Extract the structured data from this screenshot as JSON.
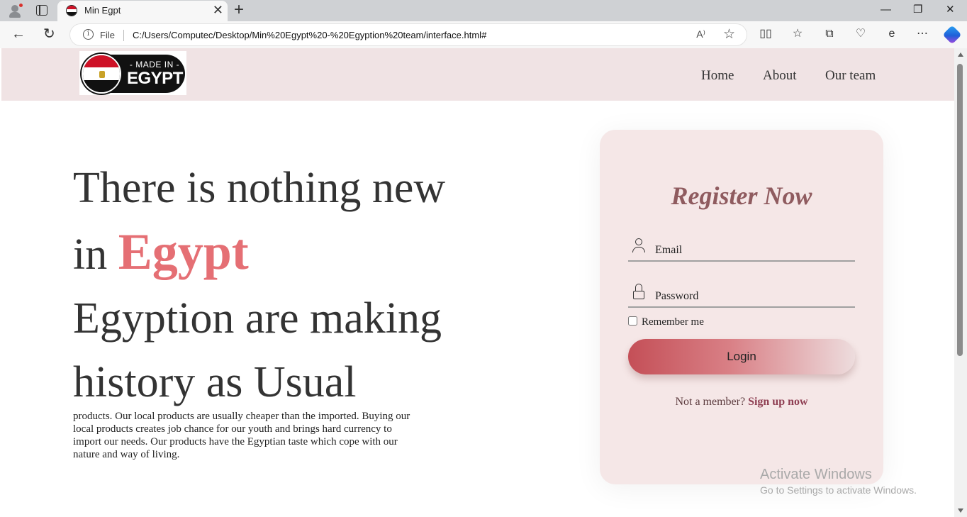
{
  "browser": {
    "tab_title": "Min Egpt",
    "tab_close": "✕",
    "new_tab": "+",
    "window_controls": {
      "minimize": "—",
      "restore": "❐",
      "close": "✕"
    },
    "nav": {
      "back": "←",
      "reload": "↻"
    },
    "address": {
      "scheme_label": "File",
      "url": "C:/Users/Computec/Desktop/Min%20Egypt%20-%20Egyption%20team/interface.html#",
      "read_aloud": "A⁾",
      "favorite": "☆"
    },
    "toolbar_icons": [
      "split-screen-icon",
      "favorites-icon",
      "collections-icon",
      "performance-icon",
      "edge-bar-icon",
      "more-icon",
      "copilot-icon"
    ]
  },
  "site": {
    "logo": {
      "line1": "- MADE IN -",
      "line2": "EGYPT"
    },
    "nav": [
      "Home",
      "About",
      "Our team"
    ],
    "hero": {
      "line1": "There is nothing new",
      "line2_prefix": "in ",
      "line2_accent": "Egypt",
      "line3": "Egyption are making",
      "line4": "history as Usual",
      "description": "products. Our local products are usually cheaper than the imported. Buying our local products creates job chance for our youth and brings hard currency to import our needs. Our products have the Egyptian taste which cope with our nature and way of living."
    },
    "register": {
      "title": "Register Now",
      "email_placeholder": "Email",
      "password_placeholder": "Password",
      "remember_label": "Remember me",
      "remember_checked": false,
      "login_label": "Login",
      "signup_prefix": "Not a member? ",
      "signup_link": "Sign up now"
    },
    "colors": {
      "header_bg": "#f0e3e4",
      "accent": "#e56f74",
      "card_bg": "#f5e7e7",
      "title": "#8f5b5f"
    }
  },
  "os_watermark": {
    "line1": "Activate Windows",
    "line2": "Go to Settings to activate Windows."
  }
}
